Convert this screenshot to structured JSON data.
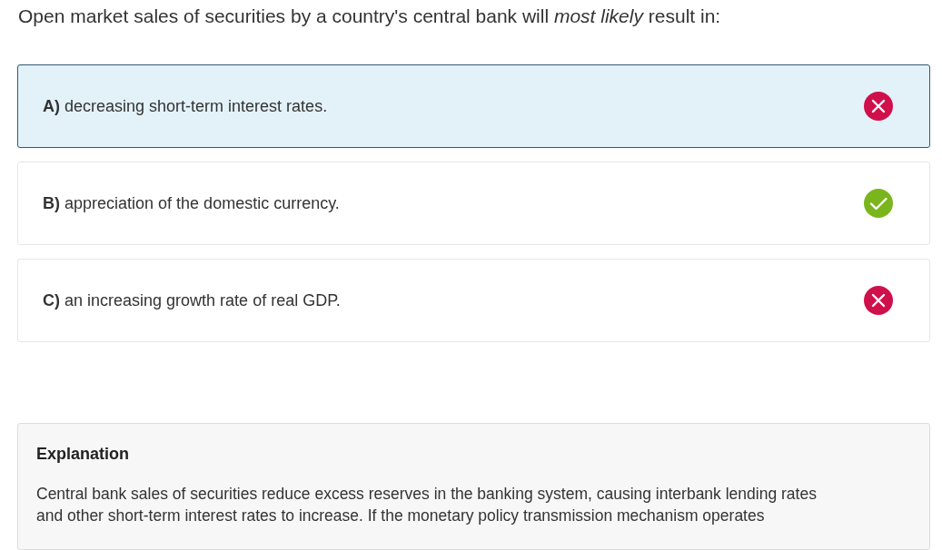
{
  "question": "Open market sales of securities by a country's central bank will *most likely* result in:",
  "options": [
    {
      "letter": "A)",
      "text": "decreasing short-term interest rates.",
      "selected": true,
      "kind": "incorrect"
    },
    {
      "letter": "B)",
      "text": "appreciation of the domestic currency.",
      "selected": false,
      "kind": "correct"
    },
    {
      "letter": "C)",
      "text": "an increasing growth rate of real GDP.",
      "selected": false,
      "kind": "incorrect"
    }
  ],
  "explanation": {
    "title": "Explanation",
    "lines": [
      "Central bank sales of securities reduce excess reserves in the banking system, causing interbank lending rates",
      "and other short-term interest rates to increase. If the monetary policy transmission mechanism operates"
    ]
  }
}
